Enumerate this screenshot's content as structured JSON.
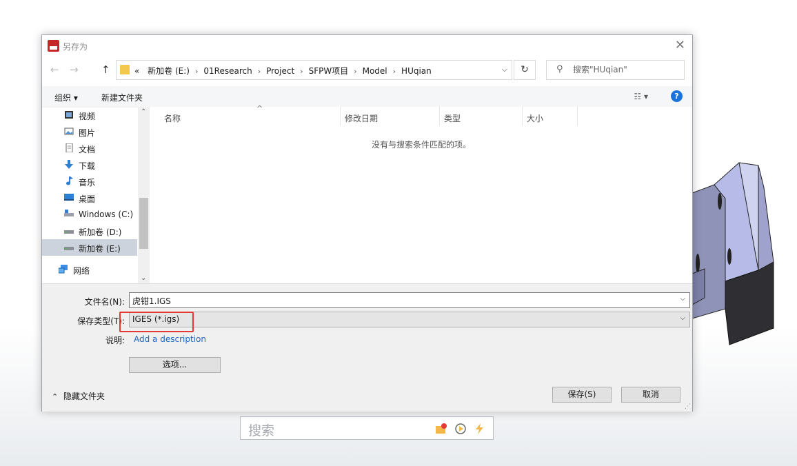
{
  "dialog": {
    "title": "另存为",
    "close_label": "✕"
  },
  "address": {
    "overflow": "«",
    "crumbs": [
      "新加卷 (E:)",
      "01Research",
      "Project",
      "SFPW项目",
      "Model",
      "HUqian"
    ]
  },
  "search": {
    "placeholder": "搜索\"HUqian\""
  },
  "toolbar": {
    "organize": "组织 ▾",
    "new_folder": "新建文件夹",
    "help": "?"
  },
  "nav": {
    "items": [
      {
        "label": "视频",
        "icon": "video-icon"
      },
      {
        "label": "图片",
        "icon": "picture-icon"
      },
      {
        "label": "文档",
        "icon": "document-icon"
      },
      {
        "label": "下载",
        "icon": "download-icon"
      },
      {
        "label": "音乐",
        "icon": "music-icon"
      },
      {
        "label": "桌面",
        "icon": "desktop-icon"
      },
      {
        "label": "Windows (C:)",
        "icon": "drive-icon"
      },
      {
        "label": "新加卷 (D:)",
        "icon": "drive-icon"
      },
      {
        "label": "新加卷 (E:)",
        "icon": "drive-icon",
        "selected": true
      },
      {
        "label": "网络",
        "icon": "network-icon"
      }
    ]
  },
  "filelist": {
    "columns": [
      "名称",
      "修改日期",
      "类型",
      "大小"
    ],
    "empty_message": "没有与搜索条件匹配的项。"
  },
  "form": {
    "filename_label": "文件名(N):",
    "filename_value": "虎钳1.IGS",
    "filetype_label": "保存类型(T):",
    "filetype_value": "IGES (*.igs)",
    "description_label": "说明:",
    "description_link": "Add a description",
    "options_button": "选项...",
    "hide_folders": "隐藏文件夹",
    "save_button": "保存(S)",
    "cancel_button": "取消"
  },
  "host": {
    "search_placeholder": "搜索"
  },
  "colors": {
    "accent": "#1a73d9",
    "highlight": "#e53935",
    "selected_nav": "#ccd3dc"
  }
}
